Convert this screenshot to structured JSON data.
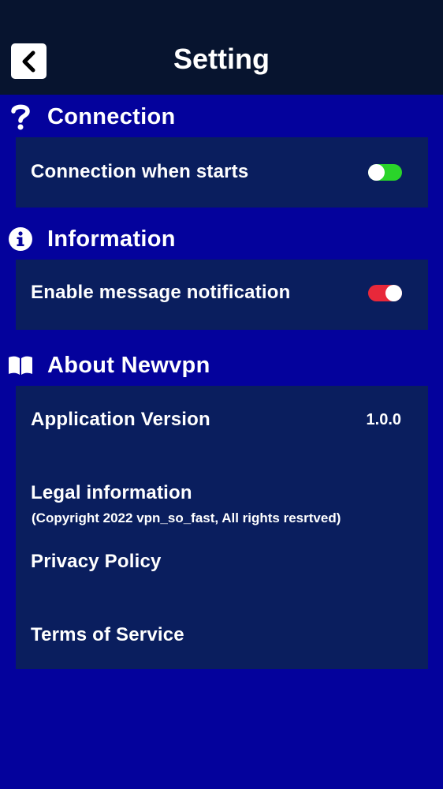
{
  "header": {
    "title": "Setting",
    "back_icon": "chevron-left-icon"
  },
  "sections": {
    "connection": {
      "title": "Connection",
      "icon": "question-icon",
      "rows": [
        {
          "label": "Connection when starts",
          "toggle_on": true,
          "toggle_color": "#2ad42a"
        }
      ]
    },
    "information": {
      "title": "Information",
      "icon": "info-circle-icon",
      "rows": [
        {
          "label": "Enable message notification",
          "toggle_on": true,
          "toggle_color": "#e8283a"
        }
      ]
    },
    "about": {
      "title": "About Newvpn",
      "icon": "open-book-icon",
      "version_label": "Application Version",
      "version_value": "1.0.0",
      "legal_label": "Legal information",
      "legal_sub": "(Copyright 2022 vpn_so_fast, All rights resrtved)",
      "privacy_label": "Privacy Policy",
      "terms_label": "Terms of Service"
    }
  },
  "colors": {
    "background": "#04029c",
    "header_bg": "#07142f",
    "panel_bg": "#0a1e5e",
    "text": "#ffffff"
  }
}
